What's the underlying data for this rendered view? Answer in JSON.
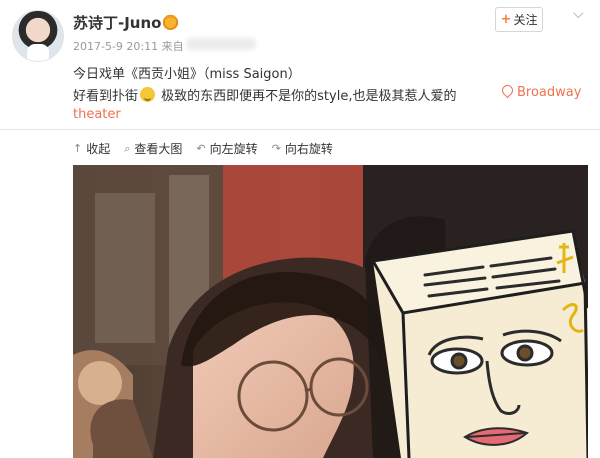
{
  "post": {
    "username": "苏诗丁-Juno",
    "time": "2017-5-9 20:11",
    "source_prefix": "来自",
    "line1": "今日戏单《西贡小姐》（miss Saigon）",
    "line2_a": "好看到扑街",
    "line2_b": " 极致的东西即便再不是你的style,也是极其惹人爱的",
    "location_a": "Broadway",
    "location_b": "theater"
  },
  "header": {
    "follow_label": "关注",
    "follow_plus": "+",
    "more_glyph": "⌵"
  },
  "toolbar": {
    "items": [
      {
        "icon": "arrow-up-icon",
        "glyph": "↑",
        "label": "收起"
      },
      {
        "icon": "zoom-icon",
        "glyph": "⌕",
        "label": "查看大图"
      },
      {
        "icon": "rotate-left-icon",
        "glyph": "↶",
        "label": "向左旋转"
      },
      {
        "icon": "rotate-right-icon",
        "glyph": "↷",
        "label": "向右旋转"
      }
    ]
  },
  "colors": {
    "accent": "#eb7350",
    "text": "#333333",
    "meta": "#999999"
  }
}
